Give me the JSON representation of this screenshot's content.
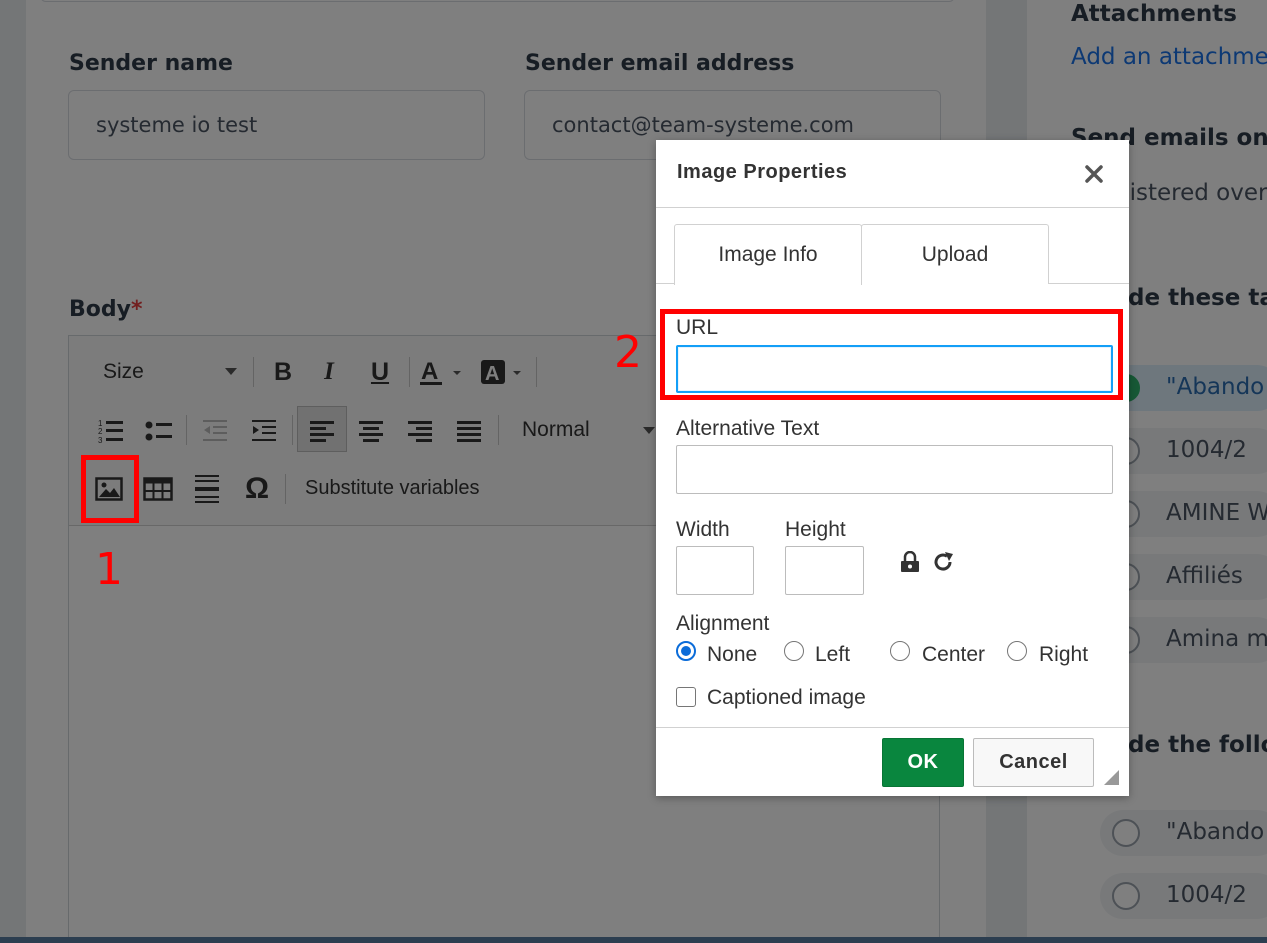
{
  "form": {
    "sender_name_label": "Sender name",
    "sender_name_value": "systeme io test",
    "sender_email_label": "Sender email address",
    "sender_email_value": "contact@team-systeme.com",
    "body_label": "Body",
    "required_mark": "*"
  },
  "toolbar": {
    "size_label": "Size",
    "format_label": "Normal",
    "substitute_label": "Substitute variables"
  },
  "sidebar": {
    "attachments_label": "Attachments",
    "add_attachment_link": "Add an attachme",
    "send_only_label": "Send emails only",
    "registered_text": "gistered over",
    "include_tags_label": "de these tag",
    "tags": [
      {
        "label": "\"Abando",
        "checked": true
      },
      {
        "label": "1004/2",
        "checked": false
      },
      {
        "label": "AMINE W",
        "checked": false
      },
      {
        "label": "Affiliés",
        "checked": false
      },
      {
        "label": "Amina m",
        "checked": false
      }
    ],
    "exclude_tags_label": "de the follo",
    "exclude_tags": [
      {
        "label": "\"Abando"
      },
      {
        "label": "1004/2"
      }
    ]
  },
  "dialog": {
    "title": "Image Properties",
    "tabs": [
      {
        "label": "Image Info",
        "active": true
      },
      {
        "label": "Upload",
        "active": false
      }
    ],
    "url_label": "URL",
    "url_value": "",
    "alt_label": "Alternative Text",
    "alt_value": "",
    "width_label": "Width",
    "height_label": "Height",
    "alignment_label": "Alignment",
    "alignment_options": [
      "None",
      "Left",
      "Center",
      "Right"
    ],
    "alignment_selected": "None",
    "captioned_label": "Captioned image",
    "ok_label": "OK",
    "cancel_label": "Cancel"
  },
  "annotations": {
    "step1": "1",
    "step2": "2",
    "color": "#ff0000"
  },
  "colors": {
    "ok_button": "#09863e",
    "focus_blue": "#139ff7",
    "link_blue": "#1a73e8",
    "tag_green": "#2fb36c"
  }
}
